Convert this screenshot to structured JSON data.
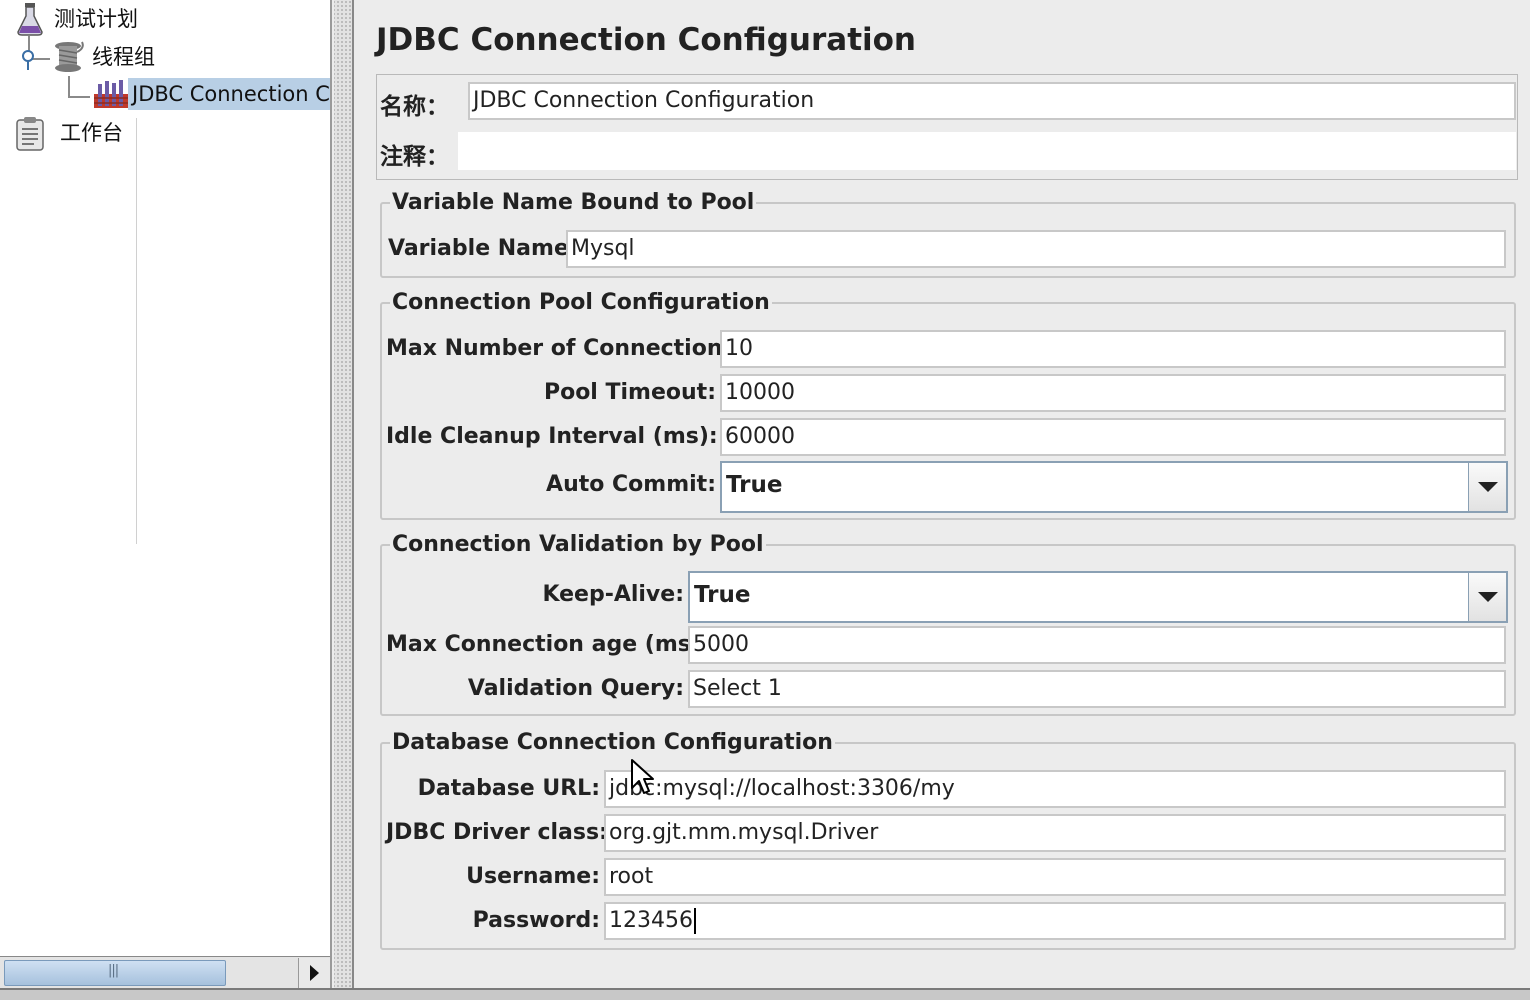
{
  "tree": {
    "items": [
      {
        "label": "测试计划",
        "icon": "flask-icon"
      },
      {
        "label": "线程组",
        "icon": "spool-icon"
      },
      {
        "label": "JDBC Connection Co",
        "icon": "database-config-icon",
        "selected": true
      },
      {
        "label": "工作台",
        "icon": "clipboard-icon"
      }
    ]
  },
  "config": {
    "title": "JDBC Connection Configuration",
    "name_label": "名称：",
    "name_value": "JDBC Connection Configuration",
    "comment_label": "注释：",
    "comment_value": "",
    "groups": {
      "variable": {
        "title": "Variable Name Bound to Pool",
        "variable_name_label": "Variable Name:",
        "variable_name_value": "Mysql"
      },
      "pool": {
        "title": "Connection Pool Configuration",
        "max_connections_label": "Max Number of Connections:",
        "max_connections_value": "10",
        "pool_timeout_label": "Pool Timeout:",
        "pool_timeout_value": "10000",
        "idle_cleanup_label": "Idle Cleanup Interval (ms):",
        "idle_cleanup_value": "60000",
        "auto_commit_label": "Auto Commit:",
        "auto_commit_value": "True"
      },
      "validation": {
        "title": "Connection Validation by Pool",
        "keep_alive_label": "Keep-Alive:",
        "keep_alive_value": "True",
        "max_age_label": "Max Connection age (ms):",
        "max_age_value": "5000",
        "validation_query_label": "Validation Query:",
        "validation_query_value": "Select 1"
      },
      "database": {
        "title": "Database Connection Configuration",
        "url_label": "Database URL:",
        "url_value": "jdbc:mysql://localhost:3306/my",
        "driver_label": "JDBC Driver class:",
        "driver_value": "org.gjt.mm.mysql.Driver",
        "username_label": "Username:",
        "username_value": "root",
        "password_label": "Password:",
        "password_value": "123456"
      }
    }
  },
  "colors": {
    "selection": "#b8cfe5",
    "panel_bg": "#ececec",
    "field_bg": "#ffffff"
  }
}
